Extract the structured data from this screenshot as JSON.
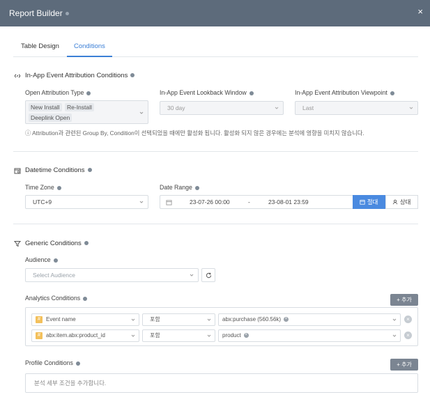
{
  "window": {
    "title": "Report Builder",
    "close_glyph": "×"
  },
  "tabs": [
    {
      "label": "Table Design"
    },
    {
      "label": "Conditions"
    }
  ],
  "in_app": {
    "title": "In-App Event Attribution Conditions",
    "open_attr": {
      "label": "Open Attribution Type",
      "values": [
        "New Install",
        "Re-Install",
        "Deeplink Open"
      ]
    },
    "lookback": {
      "label": "In-App Event Lookback Window",
      "value": "30 day"
    },
    "viewpoint": {
      "label": "In-App Event Attribution Viewpoint",
      "value": "Last"
    },
    "hint": "ⓘ Attribution과 관련된 Group By, Condition이 선택되었을 때에만 활성화 됩니다. 활성화 되지 않은 경우에는 분석에 영향을 미치지 않습니다."
  },
  "datetime": {
    "title": "Datetime Conditions",
    "timezone": {
      "label": "Time Zone",
      "value": "UTC+9"
    },
    "date_range": {
      "label": "Date Range",
      "start": "23-07-26 00:00",
      "separator": "-",
      "end": "23-08-01 23:59",
      "absolute_label": "절대",
      "relative_label": "상대"
    }
  },
  "generic": {
    "title": "Generic Conditions",
    "audience": {
      "label": "Audience",
      "placeholder": "Select Audience"
    },
    "analytics": {
      "label": "Analytics Conditions",
      "add_label": "+ 추가",
      "rows": [
        {
          "field": "Event name",
          "operator": "포함",
          "value": "abx:purchase (560.56k)"
        },
        {
          "field": "abx:item.abx:product_id",
          "operator": "포함",
          "value": "product"
        }
      ]
    },
    "profile": {
      "label": "Profile Conditions",
      "add_label": "+ 추가",
      "empty_text": "분석 세부 조건을 추가합니다."
    }
  },
  "colors": {
    "titlebar": "#5d6b7b",
    "accent": "#3b7fd6",
    "abs_button": "#4a8ae0",
    "add_button": "#7b8592",
    "hash_badge": "#f3c05b"
  }
}
